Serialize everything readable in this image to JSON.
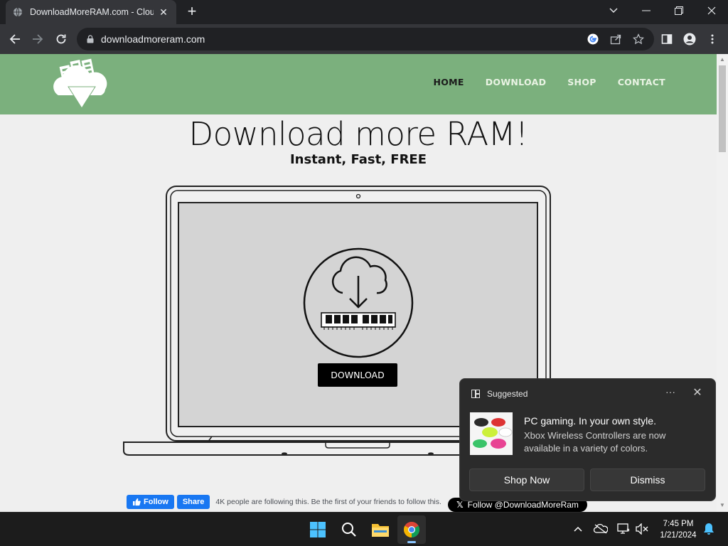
{
  "browser": {
    "tab_title": "DownloadMoreRAM.com - Cloud",
    "tab_close": "✕",
    "new_tab": "+",
    "url": "downloadmoreram.com"
  },
  "site": {
    "nav": [
      "HOME",
      "DOWNLOAD",
      "SHOP",
      "CONTACT"
    ],
    "title": "Download more RAM!",
    "subtitle": "Instant, Fast, FREE",
    "download_button": "DOWNLOAD",
    "facebook_follow": "Follow",
    "facebook_share": "Share",
    "facebook_text": "4K people are following this. Be the first of your friends to follow this.",
    "twitter_follow": "Follow @DownloadMoreRam"
  },
  "notification": {
    "header": "Suggested",
    "more": "···",
    "close": "✕",
    "title": "PC gaming. In your own style.",
    "body": "Xbox Wireless Controllers are now available in a variety of colors.",
    "primary_button": "Shop Now",
    "secondary_button": "Dismiss"
  },
  "taskbar": {
    "time": "7:45 PM",
    "date": "1/21/2024",
    "tray_chevron": "^"
  },
  "colors": {
    "header_green": "#7bb07d",
    "browser_dark": "#35363a",
    "toast_bg": "#2b2b2b"
  }
}
